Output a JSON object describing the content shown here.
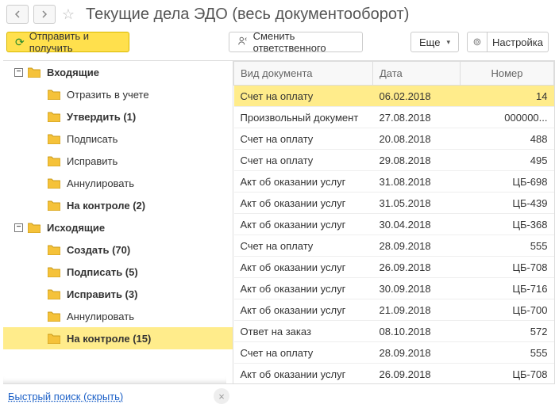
{
  "header": {
    "title": "Текущие дела ЭДО (весь документооборот)"
  },
  "toolbar": {
    "send_receive": "Отправить и получить",
    "change_responsible": "Сменить ответственного",
    "more": "Еще",
    "settings": "Настройка"
  },
  "tree": {
    "incoming": {
      "label": "Входящие"
    },
    "in_items": [
      {
        "label": "Отразить в учете",
        "bold": false
      },
      {
        "label": "Утвердить (1)",
        "bold": true
      },
      {
        "label": "Подписать",
        "bold": false
      },
      {
        "label": "Исправить",
        "bold": false
      },
      {
        "label": "Аннулировать",
        "bold": false
      },
      {
        "label": "На контроле (2)",
        "bold": true
      }
    ],
    "outgoing": {
      "label": "Исходящие"
    },
    "out_items": [
      {
        "label": "Создать (70)",
        "bold": true
      },
      {
        "label": "Подписать (5)",
        "bold": true
      },
      {
        "label": "Исправить (3)",
        "bold": true
      },
      {
        "label": "Аннулировать",
        "bold": false
      },
      {
        "label": "На контроле (15)",
        "bold": true,
        "selected": true
      }
    ]
  },
  "columns": {
    "doc_type": "Вид документа",
    "date": "Дата",
    "number": "Номер"
  },
  "rows": [
    {
      "type": "Счет на оплату",
      "date": "06.02.2018",
      "num": "14",
      "sel": true
    },
    {
      "type": "Произвольный документ",
      "date": "27.08.2018",
      "num": "000000..."
    },
    {
      "type": "Счет на оплату",
      "date": "20.08.2018",
      "num": "488"
    },
    {
      "type": "Счет на оплату",
      "date": "29.08.2018",
      "num": "495"
    },
    {
      "type": "Акт об оказании услуг",
      "date": "31.08.2018",
      "num": "ЦБ-698"
    },
    {
      "type": "Акт об оказании услуг",
      "date": "31.05.2018",
      "num": "ЦБ-439"
    },
    {
      "type": "Акт об оказании услуг",
      "date": "30.04.2018",
      "num": "ЦБ-368"
    },
    {
      "type": "Счет на оплату",
      "date": "28.09.2018",
      "num": "555"
    },
    {
      "type": "Акт об оказании услуг",
      "date": "26.09.2018",
      "num": "ЦБ-708"
    },
    {
      "type": "Акт об оказании услуг",
      "date": "30.09.2018",
      "num": "ЦБ-716"
    },
    {
      "type": "Акт об оказании услуг",
      "date": "21.09.2018",
      "num": "ЦБ-700"
    },
    {
      "type": "Ответ на заказ",
      "date": "08.10.2018",
      "num": "572"
    },
    {
      "type": "Счет на оплату",
      "date": "28.09.2018",
      "num": "555"
    },
    {
      "type": "Акт об оказании услуг",
      "date": "26.09.2018",
      "num": "ЦБ-708"
    }
  ],
  "footer": {
    "quick_search": "Быстрый поиск (скрыть)"
  }
}
